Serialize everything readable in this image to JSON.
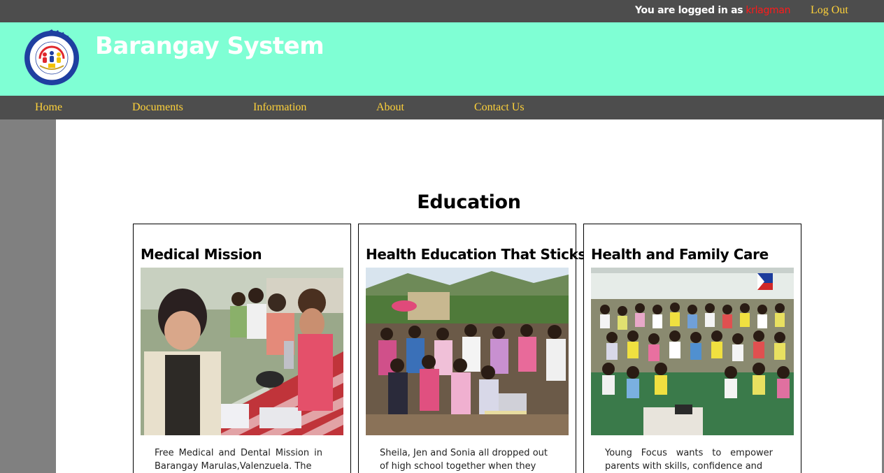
{
  "topbar": {
    "login_prefix": "You are logged in as",
    "username": "krlagman",
    "logout_label": "Log Out"
  },
  "header": {
    "title": "Barangay System",
    "logo_icon": "barangay-seal-icon",
    "background_color": "#7fffd4"
  },
  "nav": {
    "items": [
      {
        "label": "Home"
      },
      {
        "label": "Documents"
      },
      {
        "label": "Information"
      },
      {
        "label": "About"
      },
      {
        "label": "Contact Us"
      }
    ]
  },
  "main": {
    "section_title": "Education",
    "cards": [
      {
        "title": "Medical Mission",
        "image": "medical-mission-photo",
        "text": "Free Medical and Dental Mission in Barangay Marulas,Valenzuela. The"
      },
      {
        "title": "Health Education That Sticks",
        "image": "health-education-photo",
        "text": "Sheila, Jen and Sonia all dropped out of high school together when they"
      },
      {
        "title": "Health and Family Care",
        "image": "family-care-photo",
        "text": "Young Focus wants to empower parents with skills, confidence and"
      }
    ]
  },
  "colors": {
    "bars": "#4d4d4d",
    "nav_text": "#ffd23a",
    "username": "#ff1a1a",
    "gutter": "#808080"
  }
}
